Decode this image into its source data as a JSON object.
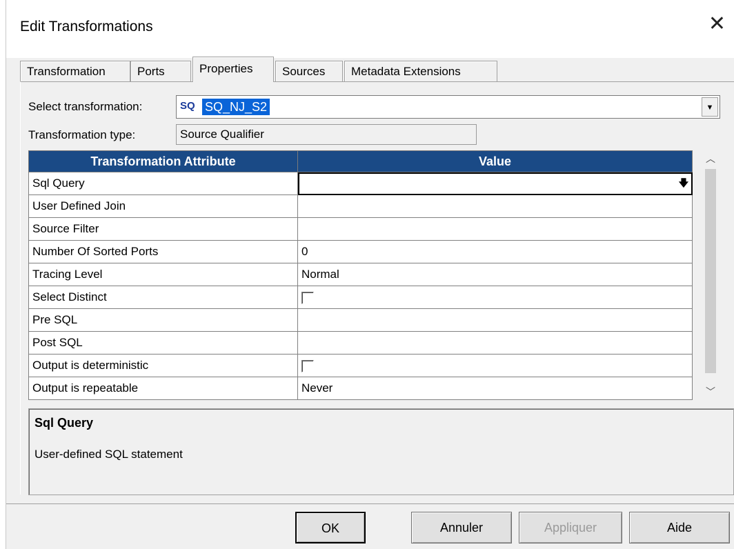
{
  "dialog": {
    "title": "Edit Transformations",
    "close_symbol": "✕"
  },
  "tabs": [
    {
      "label": "Transformation",
      "active": false
    },
    {
      "label": "Ports",
      "active": false
    },
    {
      "label": "Properties",
      "active": true
    },
    {
      "label": "Sources",
      "active": false
    },
    {
      "label": "Metadata Extensions",
      "active": false
    }
  ],
  "select_transformation": {
    "label": "Select transformation:",
    "icon_text": "SQ",
    "value": "SQ_NJ_S2"
  },
  "transformation_type": {
    "label": "Transformation type:",
    "value": "Source Qualifier"
  },
  "grid": {
    "headers": [
      "Transformation Attribute",
      "Value"
    ],
    "rows": [
      {
        "attr": "Sql Query",
        "value": "",
        "kind": "edit"
      },
      {
        "attr": "User Defined Join",
        "value": "",
        "kind": "text"
      },
      {
        "attr": "Source Filter",
        "value": "",
        "kind": "text"
      },
      {
        "attr": "Number Of Sorted Ports",
        "value": "0",
        "kind": "text"
      },
      {
        "attr": "Tracing Level",
        "value": "Normal",
        "kind": "text"
      },
      {
        "attr": "Select Distinct",
        "value": "",
        "kind": "checkbox"
      },
      {
        "attr": "Pre SQL",
        "value": "",
        "kind": "text"
      },
      {
        "attr": "Post SQL",
        "value": "",
        "kind": "text"
      },
      {
        "attr": "Output is deterministic",
        "value": "",
        "kind": "checkbox"
      },
      {
        "attr": "Output is repeatable",
        "value": "Never",
        "kind": "text"
      }
    ]
  },
  "description": {
    "title": "Sql Query",
    "text": "User-defined SQL statement"
  },
  "buttons": {
    "ok": "OK",
    "cancel": "Annuler",
    "apply": "Appliquer",
    "help": "Aide"
  }
}
